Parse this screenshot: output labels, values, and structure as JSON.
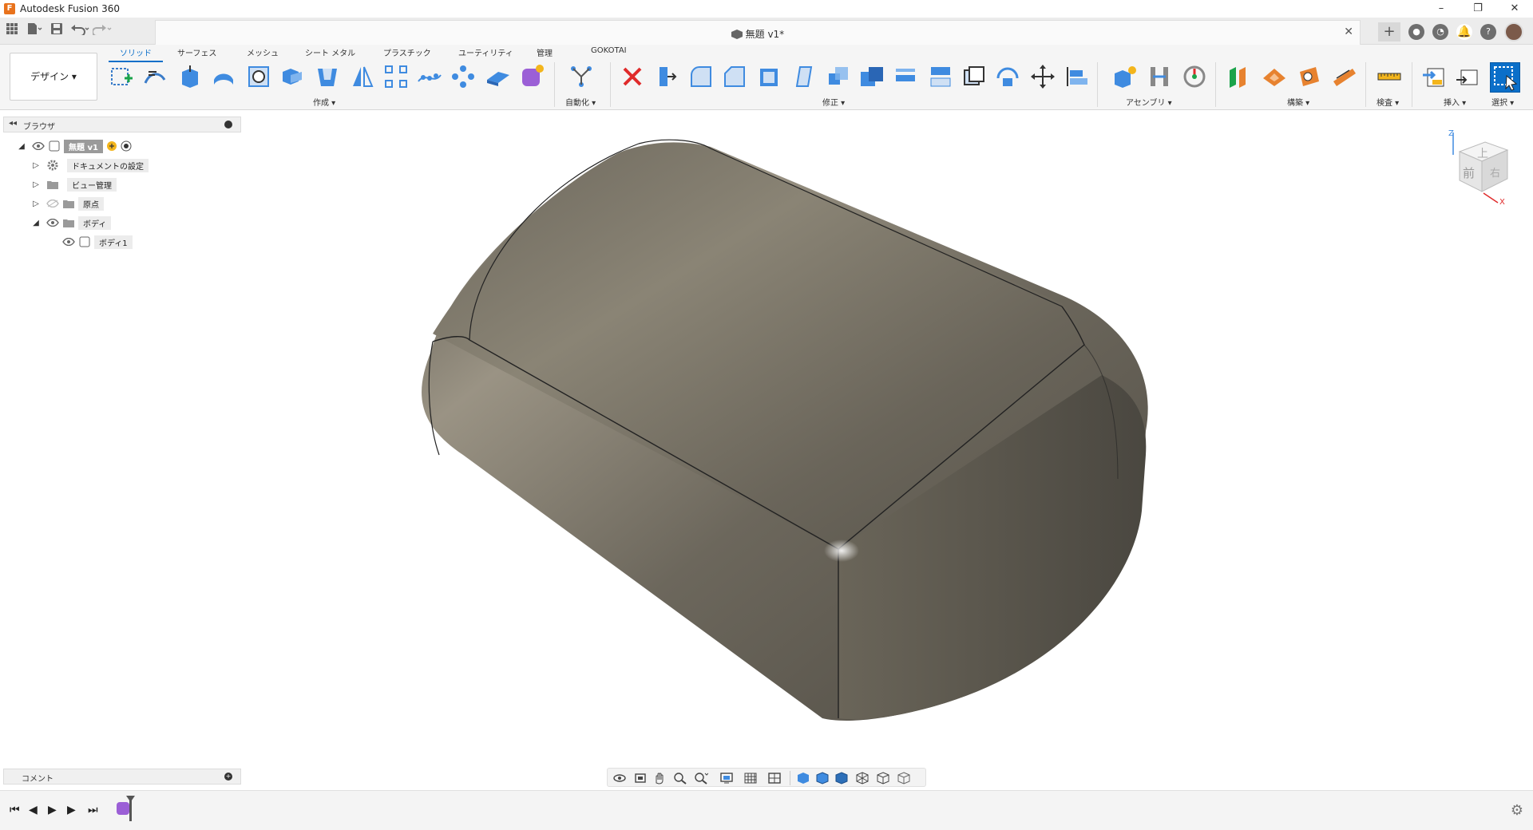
{
  "titlebar": {
    "app_title": "Autodesk Fusion 360",
    "logo_letter": "F"
  },
  "window_controls": {
    "minimize": "–",
    "restore": "❐",
    "close": "✕"
  },
  "document_tab": {
    "title": "無題 v1*",
    "close": "✕"
  },
  "workspace": {
    "label": "デザイン ▾"
  },
  "ribbon_tabs": [
    "ソリッド",
    "サーフェス",
    "メッシュ",
    "シート メタル",
    "プラスチック",
    "ユーティリティ",
    "管理",
    "GOKOTAI"
  ],
  "ribbon_groups": {
    "create": "作成 ▾",
    "automate": "自動化 ▾",
    "modify": "修正 ▾",
    "assemble": "アセンブリ ▾",
    "construct": "構築 ▾",
    "inspect": "検査 ▾",
    "insert": "挿入 ▾",
    "select": "選択 ▾"
  },
  "browser": {
    "title": "ブラウザ",
    "root": "無題 v1",
    "items": [
      {
        "label": "ドキュメントの設定"
      },
      {
        "label": "ビュー管理"
      },
      {
        "label": "原点"
      },
      {
        "label": "ボディ"
      },
      {
        "label": "ボディ1"
      }
    ]
  },
  "comments": {
    "title": "コメント"
  },
  "viewcube": {
    "top": "上",
    "front": "前",
    "right": "右",
    "axis_z": "Z",
    "axis_x": "X"
  },
  "colors": {
    "accent": "#0b6fc9",
    "delete": "#e02b2b",
    "body": "#6b665c"
  },
  "icons": [
    "grid-icon",
    "file-icon",
    "save-icon",
    "undo-icon",
    "redo-icon",
    "plus-icon",
    "extensions-icon",
    "jobs-icon",
    "notifications-icon",
    "help-icon"
  ]
}
